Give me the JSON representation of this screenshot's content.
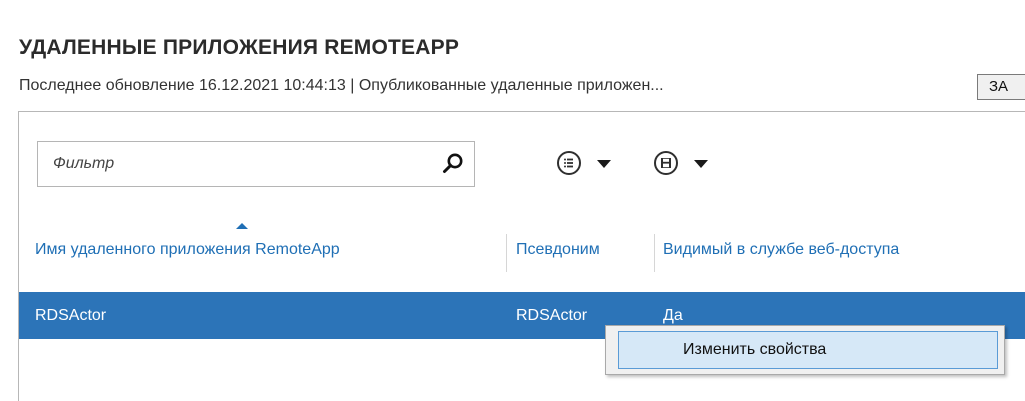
{
  "header": {
    "title": "УДАЛЕННЫЕ ПРИЛОЖЕНИЯ REMOTEAPP",
    "subtitle": "Последнее обновление 16.12.2021 10:44:13 | Опубликованные удаленные приложен...",
    "tasks_label": "ЗА"
  },
  "toolbar": {
    "filter_placeholder": "Фильтр",
    "filter_value": "",
    "search_icon": "search-icon",
    "view_icon": "list-icon",
    "save_icon": "save-icon"
  },
  "table": {
    "columns": [
      {
        "label": "Имя удаленного приложения RemoteApp",
        "sorted": "ascending"
      },
      {
        "label": "Псевдоним"
      },
      {
        "label": "Видимый в службе веб-доступа"
      }
    ],
    "rows": [
      {
        "name": "RDSActor",
        "alias": "RDSActor",
        "visible": "Да",
        "selected": true
      }
    ]
  },
  "context_menu": {
    "items": [
      {
        "label": "Изменить свойства",
        "highlighted": true
      }
    ]
  },
  "colors": {
    "accent": "#1f6fb5",
    "selection": "#2c74b8",
    "menu_highlight": "#d6e8f7"
  }
}
